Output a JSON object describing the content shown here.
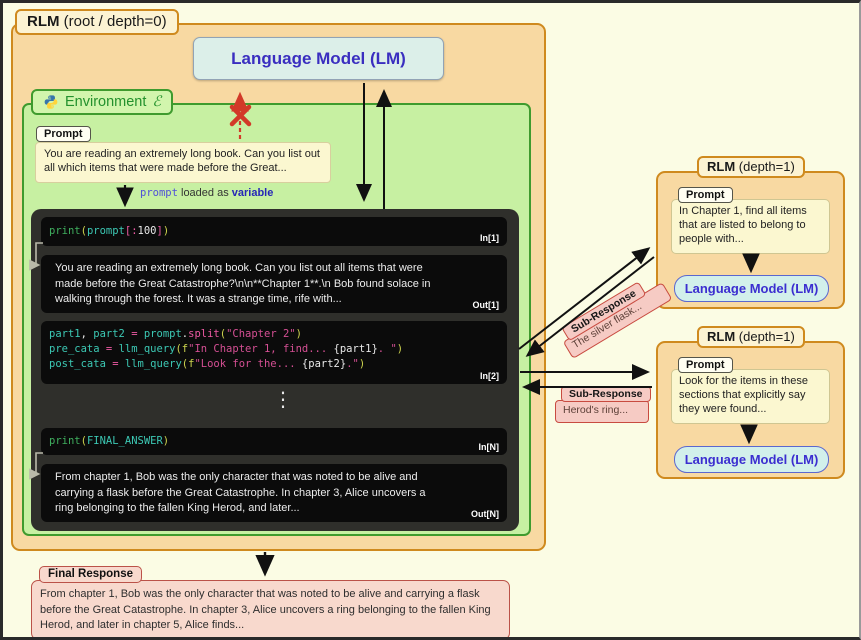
{
  "root": {
    "label_bold": "RLM",
    "label_rest": " (root / depth=0)"
  },
  "lm_main": {
    "label": "Language Model (LM)"
  },
  "environment": {
    "label": "Environment",
    "symbol": "ℰ",
    "icon": "python-icon"
  },
  "prompt_root": {
    "label": "Prompt",
    "text": "You are reading an extremely long book. Can you list out all which items that were made before the Great..."
  },
  "loaded_note": {
    "code": "prompt",
    "mid": " loaded as ",
    "bold": "variable"
  },
  "repl": {
    "ellipsis": "⋮",
    "cells": {
      "in1": {
        "label": "In[1]",
        "lines": [
          [
            {
              "t": "print",
              "c": "fn"
            },
            {
              "t": "(",
              "c": "par"
            },
            {
              "t": "prompt",
              "c": "id"
            },
            {
              "t": "[",
              "c": "op"
            },
            {
              "t": ":",
              "c": "op"
            },
            {
              "t": "100",
              "c": "pl"
            },
            {
              "t": "]",
              "c": "op"
            },
            {
              "t": ")",
              "c": "par"
            }
          ]
        ]
      },
      "out1": {
        "label": "Out[1]",
        "text": "You are reading an extremely long book. Can you list out all items that were made before the Great Catastrophe?\\n\\n**Chapter 1**.\\n Bob found solace in walking through the forest. It was a strange time, rife with..."
      },
      "in2": {
        "label": "In[2]",
        "lines": [
          [
            {
              "t": "part1",
              "c": "id"
            },
            {
              "t": ", ",
              "c": "pl"
            },
            {
              "t": "part2",
              "c": "id"
            },
            {
              "t": " ",
              "c": "pl"
            },
            {
              "t": "=",
              "c": "op"
            },
            {
              "t": " ",
              "c": "pl"
            },
            {
              "t": "prompt",
              "c": "id"
            },
            {
              "t": ".",
              "c": "pl"
            },
            {
              "t": "split",
              "c": "op"
            },
            {
              "t": "(",
              "c": "par"
            },
            {
              "t": "\"Chapter 2\"",
              "c": "str"
            },
            {
              "t": ")",
              "c": "par"
            }
          ],
          [
            {
              "t": "pre_cata",
              "c": "id"
            },
            {
              "t": " ",
              "c": "pl"
            },
            {
              "t": "=",
              "c": "op"
            },
            {
              "t": " ",
              "c": "pl"
            },
            {
              "t": "llm_query",
              "c": "id"
            },
            {
              "t": "(",
              "c": "par"
            },
            {
              "t": "f",
              "c": "par"
            },
            {
              "t": "\"In Chapter 1, find... ",
              "c": "str"
            },
            {
              "t": "{part1}",
              "c": "pl"
            },
            {
              "t": ". \"",
              "c": "str"
            },
            {
              "t": ")",
              "c": "par"
            }
          ],
          [
            {
              "t": "post_cata",
              "c": "id"
            },
            {
              "t": " ",
              "c": "pl"
            },
            {
              "t": "=",
              "c": "op"
            },
            {
              "t": " ",
              "c": "pl"
            },
            {
              "t": "llm_query",
              "c": "id"
            },
            {
              "t": "(",
              "c": "par"
            },
            {
              "t": "f",
              "c": "par"
            },
            {
              "t": "\"Look for the... ",
              "c": "str"
            },
            {
              "t": "{part2}",
              "c": "pl"
            },
            {
              "t": ".\"",
              "c": "str"
            },
            {
              "t": ")",
              "c": "par"
            }
          ]
        ]
      },
      "inN": {
        "label": "In[N]",
        "lines": [
          [
            {
              "t": "print",
              "c": "fn"
            },
            {
              "t": "(",
              "c": "par"
            },
            {
              "t": "FINAL_ANSWER",
              "c": "id"
            },
            {
              "t": ")",
              "c": "par"
            }
          ]
        ]
      },
      "outN": {
        "label": "Out[N]",
        "text": "From chapter 1, Bob was the only character that was noted to be alive and carrying a flask before the Great Catastrophe. In chapter 3, Alice uncovers a ring belonging to the fallen King Herod, and later..."
      }
    }
  },
  "sub_rlm_1": {
    "label_bold": "RLM",
    "label_rest": " (depth=1)",
    "prompt_label": "Prompt",
    "prompt_text": "In Chapter 1, find all items that are listed to belong to people with...",
    "lm_label": "Language Model (LM)"
  },
  "sub_rlm_2": {
    "label_bold": "RLM",
    "label_rest": " (depth=1)",
    "prompt_label": "Prompt",
    "prompt_text": "Look for the items in these sections that explicitly say they were found...",
    "lm_label": "Language Model (LM)"
  },
  "sub_response_1": {
    "label": "Sub-Response",
    "text": "The silver flask..."
  },
  "sub_response_2": {
    "label": "Sub-Response",
    "text": "Herod's ring..."
  },
  "final_response": {
    "label": "Final Response",
    "text": "From chapter 1, Bob was the only character that was noted to be alive and carrying a flask before the Great Catastrophe. In chapter 3, Alice uncovers a ring belonging to the fallen King Herod, and later in chapter 5, Alice finds..."
  },
  "colors": {
    "page_bg": "#fbfce4",
    "root_fill": "#f8d9a2",
    "root_border": "#cf8a1e",
    "env_fill": "#c7f0a2",
    "env_border": "#3f9b2e",
    "lm_fill": "#dcefe9",
    "lm_text": "#3a2ec0",
    "code_panel": "#2f2f2b",
    "code_cell": "#0b0b0b",
    "pink_fill": "#f6cbc4",
    "pink_border": "#c84b40",
    "final_fill": "#f8d9cd",
    "red_x": "#d23a28"
  }
}
